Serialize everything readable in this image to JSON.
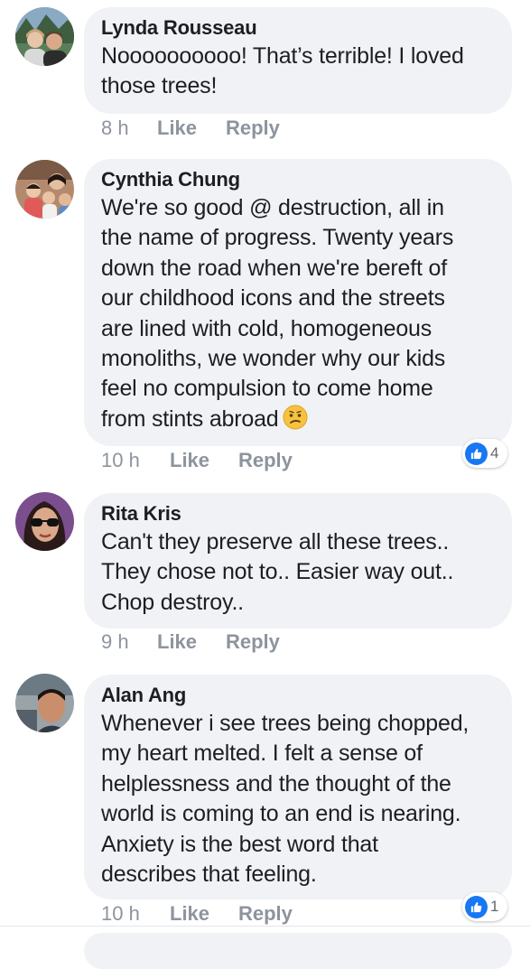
{
  "colors": {
    "bubble": "#f0f2f5",
    "meta_text": "#8d949e",
    "like_blue": "#1877f2"
  },
  "comments": [
    {
      "author": "Lynda Rousseau",
      "text": "Noooooooooo! That’s terrible! I loved\nthose trees!",
      "time": "8 h",
      "like": "Like",
      "reply": "Reply"
    },
    {
      "author": "Cynthia Chung",
      "text": "We're so good @ destruction, all in\nthe name of progress. Twenty years\ndown the road when we're bereft of\nour childhood icons and the streets\nare lined with cold, homogeneous\nmonoliths, we wonder why our kids\nfeel no compulsion to come home\nfrom stints abroad",
      "emoji": "confused-face",
      "time": "10 h",
      "like": "Like",
      "reply": "Reply",
      "reaction_icon": "like-thumb",
      "reaction_count": "4"
    },
    {
      "author": "Rita Kris",
      "text": "Can't they preserve all these trees..\nThey chose not to.. Easier way out..\nChop destroy..",
      "time": "9 h",
      "like": "Like",
      "reply": "Reply"
    },
    {
      "author": "Alan Ang",
      "text": "Whenever i see trees being chopped,\nmy heart melted. I felt a sense of\nhelplessness and the thought of the\nworld is coming to an end is nearing.\nAnxiety is the best word that\ndescribes that feeling.",
      "time": "10 h",
      "like": "Like",
      "reply": "Reply",
      "reaction_icon": "like-thumb",
      "reaction_count": "1"
    }
  ]
}
